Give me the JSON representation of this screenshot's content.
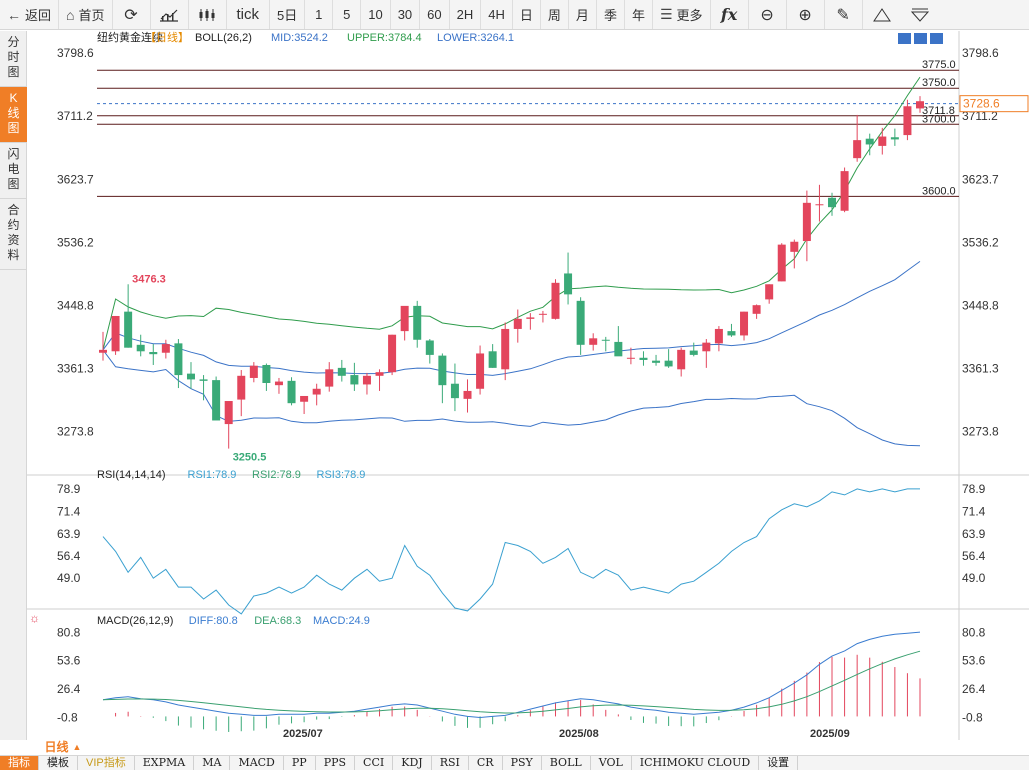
{
  "toolbar": {
    "back_label": "返回",
    "home_label": "首页",
    "tick_label": "tick",
    "periods": [
      "5日",
      "1",
      "5",
      "10",
      "30",
      "60",
      "2H",
      "4H",
      "日",
      "周",
      "月",
      "季",
      "年"
    ],
    "more_label": "更多"
  },
  "sidebar": [
    {
      "label": "分时图",
      "active": false
    },
    {
      "label": "K线图",
      "active": true
    },
    {
      "label": "闪电图",
      "active": false
    },
    {
      "label": "合约资料",
      "active": false
    }
  ],
  "main_header": {
    "symbol": "纽约黄金连续",
    "period": "【日线】",
    "boll_name": "BOLL(26,2)",
    "mid": "MID:3524.2",
    "upper": "UPPER:3784.4",
    "lower": "LOWER:3264.1"
  },
  "rsi_header": {
    "name": "RSI(14,14,14)",
    "r1": "RSI1:78.9",
    "r2": "RSI2:78.9",
    "r3": "RSI3:78.9"
  },
  "macd_header": {
    "name": "MACD(26,12,9)",
    "diff": "DIFF:80.8",
    "dea": "DEA:68.3",
    "macd": "MACD:24.9"
  },
  "price_axis_labels": [
    "3798.6",
    "3711.2",
    "3623.7",
    "3536.2",
    "3448.8",
    "3361.3",
    "3273.8"
  ],
  "rsi_axis_labels": [
    "78.9",
    "71.4",
    "63.9",
    "56.4",
    "49.0"
  ],
  "macd_axis_labels": [
    "80.8",
    "53.6",
    "26.4",
    "-0.8"
  ],
  "date_labels": [
    "2025/07",
    "2025/08",
    "2025/09"
  ],
  "current_price_tag": "3728.6",
  "annotations": {
    "high_label": "3476.3",
    "low_label": "3250.5"
  },
  "horizontal_lines": [
    {
      "label": "3775.0",
      "value": 3775.0
    },
    {
      "label": "3750.0",
      "value": 3750.0
    },
    {
      "label": "3711.8",
      "value": 3711.8
    },
    {
      "label": "3700.0",
      "value": 3700.0
    },
    {
      "label": "3600.0",
      "value": 3600.0
    }
  ],
  "colors": {
    "up": "#e3455c",
    "down": "#3aaa78",
    "boll_mid": "#3b73c7",
    "boll_band": "#2f9c4c",
    "accent": "#f07e26",
    "line": "#5a1a1a",
    "rsi": "#3aa0d0",
    "diff": "#3a7cd0",
    "dea": "#3aa070"
  },
  "bottom": {
    "period_select": "日线",
    "tabs": [
      "指标",
      "模板",
      "VIP指标",
      "EXPMA",
      "MA",
      "MACD",
      "PP",
      "PPS",
      "CCI",
      "KDJ",
      "RSI",
      "CR",
      "PSY",
      "BOLL",
      "VOL",
      "ICHIMOKU CLOUD",
      "设置"
    ]
  },
  "chart_data": {
    "type": "candlestick",
    "price_range": [
      3230,
      3810
    ],
    "candles": [
      [
        3383,
        3412,
        3372,
        3387
      ],
      [
        3385,
        3434,
        3380,
        3434
      ],
      [
        3440,
        3478,
        3390,
        3390
      ],
      [
        3394,
        3408,
        3378,
        3385
      ],
      [
        3384,
        3395,
        3366,
        3381
      ],
      [
        3383,
        3401,
        3375,
        3395
      ],
      [
        3396,
        3402,
        3334,
        3352
      ],
      [
        3354,
        3370,
        3333,
        3346
      ],
      [
        3346,
        3352,
        3317,
        3344
      ],
      [
        3345,
        3350,
        3290,
        3289
      ],
      [
        3284,
        3314,
        3250,
        3316
      ],
      [
        3318,
        3359,
        3295,
        3351
      ],
      [
        3348,
        3370,
        3342,
        3365
      ],
      [
        3366,
        3368,
        3330,
        3341
      ],
      [
        3338,
        3348,
        3326,
        3343
      ],
      [
        3344,
        3349,
        3310,
        3313
      ],
      [
        3315,
        3322,
        3298,
        3323
      ],
      [
        3325,
        3340,
        3310,
        3333
      ],
      [
        3336,
        3370,
        3329,
        3360
      ],
      [
        3362,
        3373,
        3343,
        3351
      ],
      [
        3352,
        3369,
        3330,
        3339
      ],
      [
        3339,
        3355,
        3325,
        3351
      ],
      [
        3351,
        3360,
        3330,
        3356
      ],
      [
        3356,
        3408,
        3352,
        3408
      ],
      [
        3413,
        3447,
        3400,
        3448
      ],
      [
        3448,
        3455,
        3390,
        3401
      ],
      [
        3400,
        3402,
        3368,
        3380
      ],
      [
        3379,
        3382,
        3313,
        3338
      ],
      [
        3340,
        3368,
        3302,
        3320
      ],
      [
        3319,
        3346,
        3300,
        3330
      ],
      [
        3333,
        3393,
        3325,
        3382
      ],
      [
        3385,
        3395,
        3362,
        3362
      ],
      [
        3360,
        3425,
        3345,
        3416
      ],
      [
        3416,
        3443,
        3397,
        3430
      ],
      [
        3430,
        3438,
        3415,
        3432
      ],
      [
        3436,
        3441,
        3425,
        3437
      ],
      [
        3430,
        3485,
        3429,
        3480
      ],
      [
        3493,
        3522,
        3450,
        3464
      ],
      [
        3455,
        3460,
        3380,
        3394
      ],
      [
        3394,
        3410,
        3386,
        3403
      ],
      [
        3401,
        3405,
        3385,
        3400
      ],
      [
        3398,
        3420,
        3380,
        3378
      ],
      [
        3375,
        3390,
        3367,
        3376
      ],
      [
        3376,
        3385,
        3365,
        3373
      ],
      [
        3372,
        3380,
        3365,
        3369
      ],
      [
        3372,
        3388,
        3362,
        3364
      ],
      [
        3360,
        3390,
        3350,
        3387
      ],
      [
        3386,
        3397,
        3378,
        3380
      ],
      [
        3385,
        3402,
        3362,
        3397
      ],
      [
        3396,
        3420,
        3385,
        3416
      ],
      [
        3413,
        3423,
        3405,
        3407
      ],
      [
        3407,
        3440,
        3400,
        3440
      ],
      [
        3437,
        3450,
        3430,
        3449
      ],
      [
        3457,
        3478,
        3451,
        3478
      ],
      [
        3482,
        3535,
        3482,
        3533
      ],
      [
        3523,
        3540,
        3500,
        3537
      ],
      [
        3538,
        3608,
        3510,
        3591
      ],
      [
        3589,
        3616,
        3565,
        3589
      ],
      [
        3598,
        3605,
        3573,
        3585
      ],
      [
        3580,
        3640,
        3578,
        3635
      ],
      [
        3653,
        3713,
        3648,
        3678
      ],
      [
        3680,
        3687,
        3657,
        3672
      ],
      [
        3670,
        3695,
        3658,
        3683
      ],
      [
        3682,
        3694,
        3670,
        3679
      ],
      [
        3685,
        3734,
        3678,
        3725
      ],
      [
        3722,
        3739,
        3716,
        3732
      ]
    ]
  }
}
